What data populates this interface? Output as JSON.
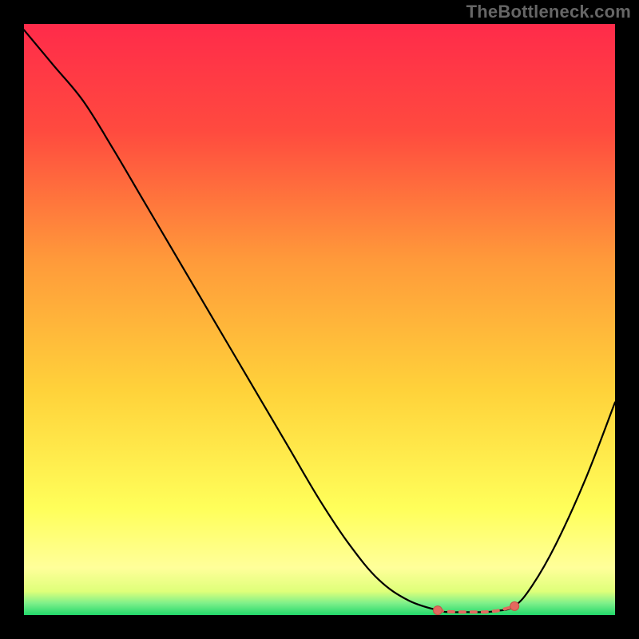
{
  "attribution": "TheBottleneck.com",
  "colors": {
    "page_bg": "#000000",
    "gradient_top": "#ff2b4a",
    "gradient_mid_upper": "#ff7a3a",
    "gradient_mid": "#ffd23a",
    "gradient_pale": "#ffff9a",
    "gradient_bottom": "#22d86b",
    "curve": "#000000",
    "marker_fill": "#e3695f",
    "marker_stroke": "#c94f45"
  },
  "chart_data": {
    "type": "line",
    "title": "",
    "xlabel": "",
    "ylabel": "",
    "xlim": [
      0,
      100
    ],
    "ylim": [
      0,
      100
    ],
    "series": [
      {
        "name": "bottleneck-curve",
        "x": [
          0,
          5,
          10,
          15,
          20,
          25,
          30,
          35,
          40,
          45,
          50,
          55,
          60,
          65,
          70,
          72,
          75,
          78,
          80,
          83,
          86,
          90,
          95,
          100
        ],
        "y": [
          99,
          93,
          87,
          79,
          70.5,
          62,
          53.5,
          45,
          36.5,
          28,
          19.5,
          12,
          6,
          2.5,
          0.8,
          0.5,
          0.5,
          0.5,
          0.7,
          1.5,
          5,
          12,
          23,
          36
        ]
      }
    ],
    "markers": {
      "name": "optimal-range",
      "x": [
        70,
        72,
        74,
        76,
        78,
        80,
        82,
        83
      ],
      "y": [
        0.8,
        0.55,
        0.5,
        0.5,
        0.5,
        0.7,
        1.2,
        1.5
      ]
    }
  }
}
